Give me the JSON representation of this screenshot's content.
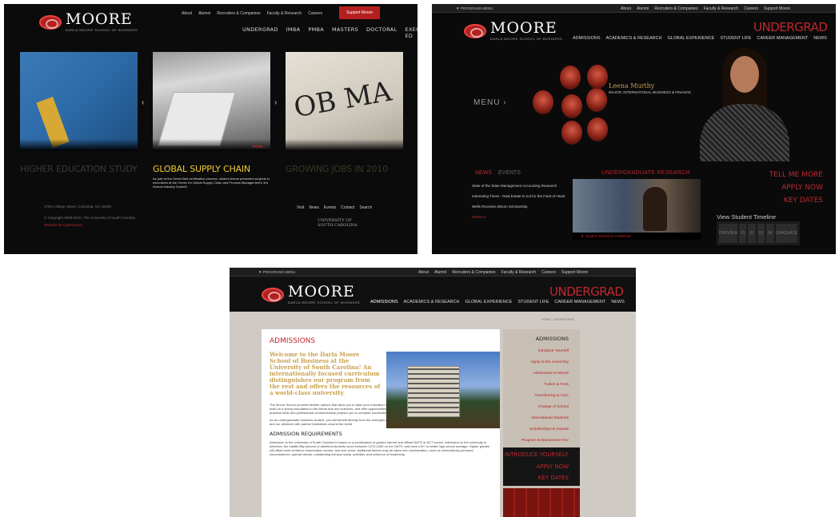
{
  "s1": {
    "logo": {
      "word": "MOORE",
      "sub": "DARLA MOORE SCHOOL OF BUSINESS"
    },
    "top_links": [
      "About",
      "Alumni",
      "Recruiters & Companies",
      "Faculty & Research",
      "Careers"
    ],
    "support": "Support Moore",
    "subnav": [
      "UNDERGRAD",
      "IMBA",
      "PMBA",
      "MASTERS",
      "DOCTORAL",
      "EXEC ED"
    ],
    "slide_more": "MORE ›",
    "cards": [
      {
        "title": "HIGHER EDUCATION STUDY",
        "color": "#2b2b2b"
      },
      {
        "title": "GLOBAL SUPPLY CHAIN",
        "color": "#f0cf33",
        "body": "As part of the Green Belt certification process, student teams presented projects to executives at the Center for Global Supply Chain and Process Management's 3rd Annual Industry Summit."
      },
      {
        "title": "GROWING JOBS IN 2010",
        "color": "#2f2a1f"
      }
    ],
    "footer": [
      "1705 College Street, Columbia, SC 29208",
      "© Copyright 2009-2010, The University of South Carolina",
      "Website by Cyberwoven"
    ],
    "footer_links": [
      "Visit",
      "News",
      "Events",
      "Contact",
      "Search"
    ],
    "usc": [
      "UNIVERSITY OF",
      "SOUTH CAROLINA"
    ]
  },
  "s2": {
    "programs_menu": "▼ PROGRAMS MENU",
    "top_links": [
      "About",
      "Alumni",
      "Recruiters & Companies",
      "Faculty & Research",
      "Careers",
      "Support Moore"
    ],
    "logo": {
      "word": "MOORE",
      "sub": "DARLA MOORE SCHOOL OF BUSINESS"
    },
    "title": "UNDERGRAD",
    "nav": [
      "ADMISSIONS",
      "ACADEMICS & RESEARCH",
      "GLOBAL EXPERIENCE",
      "STUDENT LIFE",
      "CAREER MANAGEMENT",
      "NEWS"
    ],
    "menu": "MENU ›",
    "quote": {
      "name": "Leena Murthy",
      "sub": "MAJOR: INTERNATIONAL BUSINESS & FINANCE"
    },
    "tabs": [
      "NEWS",
      "EVENTS"
    ],
    "news": [
      "State of the State Management Accounting Research",
      "Interesting Times - Real Estate to not for the Faint of Heart",
      "Wells Receives Bloom Scholarship",
      "MORE ▸"
    ],
    "research_title": "UNDERGRADUATE RESEARCH",
    "research_caption": "▼ Student Research Published",
    "side_links": [
      "TELL ME MORE",
      "APPLY NOW",
      "KEY DATES"
    ],
    "timeline_title": "View Student Timeline",
    "timeline": [
      "PREVIEW",
      "01",
      "02",
      "03",
      "04",
      "GRADUATE"
    ]
  },
  "s3": {
    "programs_menu": "▼ PROGRAMS MENU",
    "top_links": [
      "About",
      "Alumni",
      "Recruiters & Companies",
      "Faculty & Research",
      "Careers",
      "Support Moore"
    ],
    "logo": {
      "word": "MOORE",
      "sub": "DARLA MOORE SCHOOL OF BUSINESS"
    },
    "title": "UNDERGRAD",
    "nav": [
      "ADMISSIONS",
      "ACADEMICS & RESEARCH",
      "GLOBAL EXPERIENCE",
      "STUDENT LIFE",
      "CAREER MANAGEMENT",
      "NEWS"
    ],
    "crumbs": "HOME / UNDERGRAD",
    "heading": "ADMISSIONS",
    "intro": "Welcome to the Darla Moore School of Business at the University of South Carolina! An internationally focused curriculum distinguishes our program from the rest and offers the resources of a world-class university.",
    "body1": "The Moore School provides flexible options that allow you to tailor your education towards your interests and goals. Our undergraduate business programs build on a strong foundation in the liberal arts and sciences, and offer opportunities for research and academic enrichment. The continuous emphasis on practical skills and professional communication prepare you to compete successfully in a rapidly changing business world.",
    "body2": "As an undergraduate business student, you will benefit directly from the strengths reflected in our rankings, our relationships with the business community, and our alliances with partner institutions around the world.",
    "req_title": "ADMISSION REQUIREMENTS",
    "body3": "Admission to the University of South Carolina is based on a combination of grades earned and official SAT® or ACT scores. Admission to the university is selective; the middle fifty percent of admitted students score between 1070-1260 on the SAT®, and have a B+ or better high-school average. Higher grades will offset lower entrance examination scores, and vice versa. Additional factors may be taken into consideration, such as extraordinary personal circumstances, special talents, outstanding extracurricular activities, and evidence of leadership.",
    "rail_title": "ADMISSIONS",
    "rail_links": [
      "Introduce Yourself",
      "Apply to the University",
      "Admissions to Moore",
      "Tuition & Fees",
      "Transferring to USC",
      "Change of School",
      "International Students",
      "Scholarships & Awards",
      "Program Enhancement Fee"
    ],
    "rail_box": [
      "INTRODUCE YOURSELF",
      "APPLY NOW",
      "KEY DATES"
    ]
  }
}
